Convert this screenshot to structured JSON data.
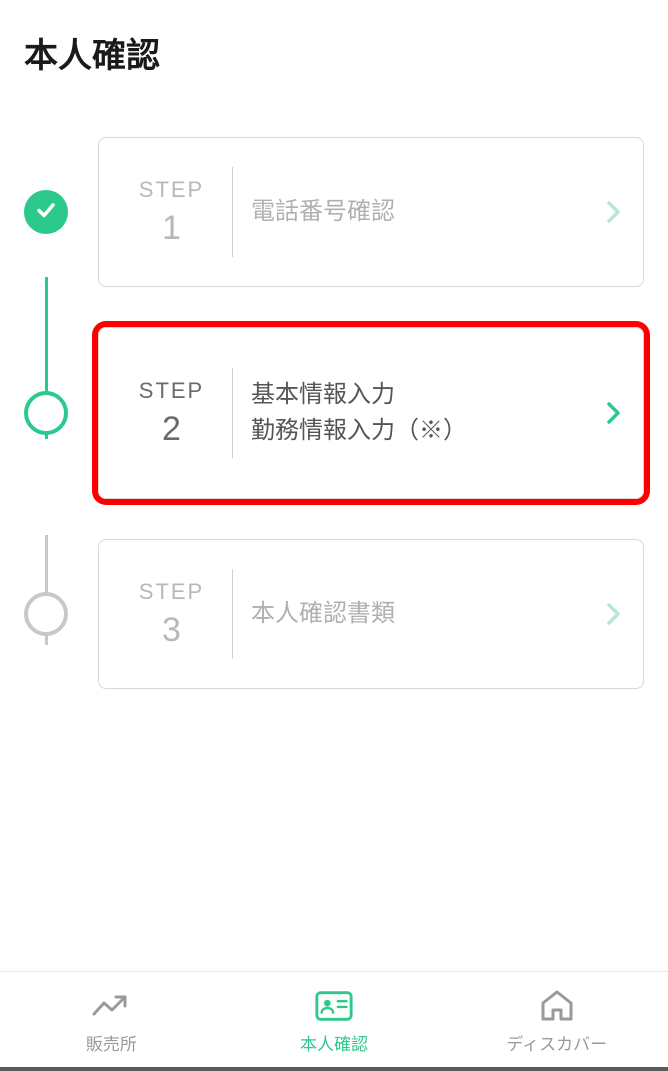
{
  "page": {
    "title": "本人確認"
  },
  "steps": [
    {
      "label": "STEP",
      "num": "1",
      "title": "電話番号確認",
      "status": "completed"
    },
    {
      "label": "STEP",
      "num": "2",
      "title_line1": "基本情報入力",
      "title_line2": "勤務情報入力（※）",
      "status": "current"
    },
    {
      "label": "STEP",
      "num": "3",
      "title": "本人確認書類",
      "status": "pending"
    }
  ],
  "nav": {
    "items": [
      {
        "label": "販売所",
        "icon": "trend",
        "active": false
      },
      {
        "label": "本人確認",
        "icon": "id-card",
        "active": true
      },
      {
        "label": "ディスカバー",
        "icon": "home",
        "active": false
      }
    ]
  },
  "colors": {
    "accent": "#2cc98c",
    "highlight": "#ff0000"
  }
}
